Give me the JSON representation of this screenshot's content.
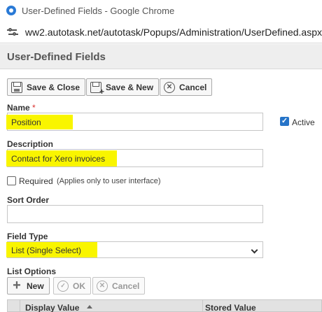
{
  "browser": {
    "window_title": "User-Defined Fields - Google Chrome",
    "url": "ww2.autotask.net/autotask/Popups/Administration/UserDefined.aspx"
  },
  "page": {
    "title": "User-Defined Fields"
  },
  "toolbar": {
    "save_close_label": "Save & Close",
    "save_new_label": "Save & New",
    "cancel_label": "Cancel"
  },
  "form": {
    "name_label": "Name",
    "name_required_marker": "*",
    "name_value": "Position",
    "active_label": "Active",
    "active_checked": true,
    "description_label": "Description",
    "description_value": "Contact for Xero invoices",
    "required_label": "Required",
    "required_hint": "(Applies only to user interface)",
    "required_checked": false,
    "sort_order_label": "Sort Order",
    "sort_order_value": "",
    "field_type_label": "Field Type",
    "field_type_value": "List (Single Select)",
    "list_options_label": "List Options"
  },
  "list_options_toolbar": {
    "new_label": "New",
    "ok_label": "OK",
    "cancel_label": "Cancel"
  },
  "list_grid": {
    "columns": [
      "Display Value",
      "Stored Value"
    ]
  },
  "colors": {
    "highlight": "#f9f500",
    "checkbox_checked": "#2674c8",
    "required_marker": "#d9302c"
  }
}
